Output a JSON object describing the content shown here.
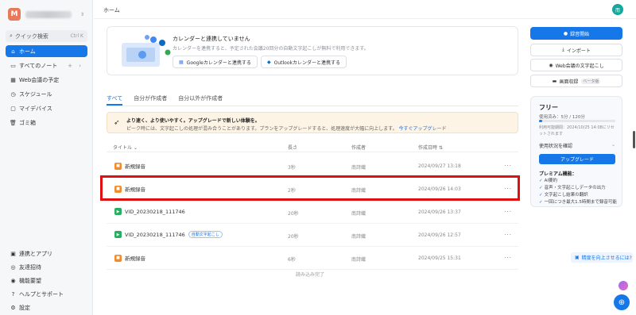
{
  "sidebar": {
    "workspace_initial": "M",
    "search_label": "クイック検索",
    "search_shortcut": "Ctrl K",
    "nav": [
      {
        "label": "ホーム",
        "icon": "home-icon"
      },
      {
        "label": "すべてのノート",
        "icon": "folder-icon"
      },
      {
        "label": "Web会議の予定",
        "icon": "calendar-icon"
      },
      {
        "label": "スケジュール",
        "icon": "clock-icon"
      },
      {
        "label": "マイデバイス",
        "icon": "device-icon"
      },
      {
        "label": "ゴミ箱",
        "icon": "trash-icon"
      }
    ],
    "bottom_nav": [
      {
        "label": "連携とアプリ",
        "icon": "apps-icon"
      },
      {
        "label": "友達招待",
        "icon": "invite-icon"
      },
      {
        "label": "機能要望",
        "icon": "lightbulb-icon"
      },
      {
        "label": "ヘルプとサポート",
        "icon": "help-icon"
      },
      {
        "label": "設定",
        "icon": "settings-icon"
      }
    ]
  },
  "header": {
    "breadcrumb": "ホーム",
    "user_avatar": "而"
  },
  "calendar_banner": {
    "title": "カレンダーと連携していません",
    "description": "カレンダーを連携すると、予定された会議20回分の自動文字起こしが無料で利用できます。",
    "google_button": "Googleカレンダーと連携する",
    "outlook_button": "Outlookカレンダーと連携する"
  },
  "tabs": [
    "すべて",
    "自分が作成者",
    "自分以外が作成者"
  ],
  "notice": {
    "title": "より速く、より使いやすく。アップグレードで新しい体験を。",
    "body": "ピーク時には、文字起こしの処理が混み合うことがあります。プランをアップグレードすると、処理速度が大幅に向上します。",
    "link": "今すぐアップグレード"
  },
  "table": {
    "headers": {
      "title": "タイトル",
      "length": "長さ",
      "creator": "作成者",
      "date": "作成日時"
    },
    "rows": [
      {
        "title": "新規録音",
        "type": "audio",
        "tag": "",
        "length": "3秒",
        "creator": "南詩織",
        "date": "2024/09/27 13:18"
      },
      {
        "title": "新規録音",
        "type": "audio",
        "tag": "",
        "length": "2秒",
        "creator": "南詩織",
        "date": "2024/09/26 14:03"
      },
      {
        "title": "VID_20230218_111746",
        "type": "video",
        "tag": "",
        "length": "20秒",
        "creator": "南詩織",
        "date": "2024/09/26 13:37"
      },
      {
        "title": "VID_20230218_111746",
        "type": "video",
        "tag": "自動文字起こし",
        "length": "20秒",
        "creator": "南詩織",
        "date": "2024/09/26 12:57"
      },
      {
        "title": "新規録音",
        "type": "audio",
        "tag": "",
        "length": "6秒",
        "creator": "南詩織",
        "date": "2024/09/25 15:31"
      }
    ],
    "load_done": "読み込み完了"
  },
  "right_panel": {
    "record_button": "録音開始",
    "import_button": "インポート",
    "web_meeting_button": "Web会議の文字起こし",
    "screen_record_button": "画面収録",
    "screen_record_badge": "ベータ版",
    "plan": {
      "name": "フリー",
      "usage": "使用済み：5分 / 120分",
      "usage_fraction": 0.04,
      "expiry": "利用可能期間：2024/10/25 14:08にリセットされます",
      "check_usage": "使用状況を確認",
      "upgrade_button": "アップグレード",
      "premium_title": "プレミアム機能：",
      "features": [
        "AI要約",
        "音声・文字起こしデータの出力",
        "文字起こし結果の翻訳",
        "一回につき最大1.5時間まで録音可能"
      ]
    }
  },
  "feedback": "精度を向上させるには?"
}
